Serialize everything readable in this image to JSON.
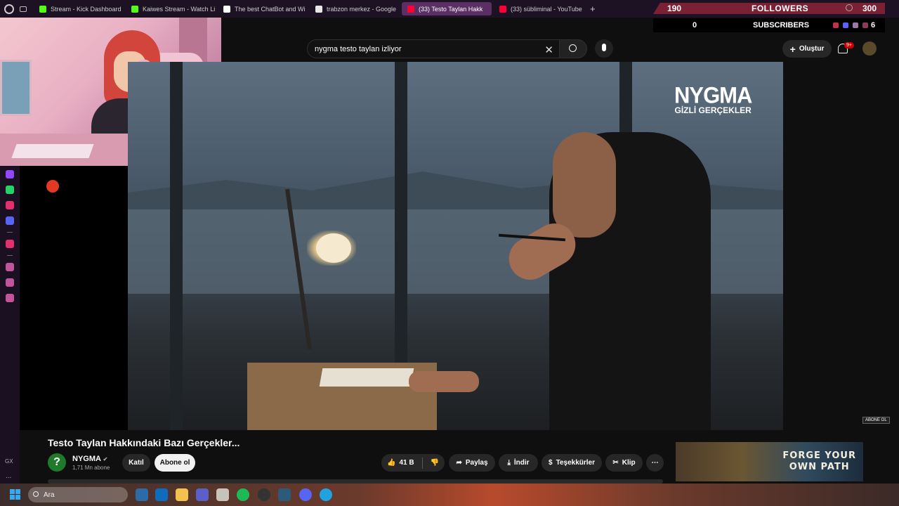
{
  "browser": {
    "tabs": [
      {
        "label": "Stream - Kick Dashboard",
        "color": "#53fc18",
        "active": false
      },
      {
        "label": "Kaiwes Stream - Watch Li",
        "color": "#53fc18",
        "active": false
      },
      {
        "label": "The best ChatBot and Wi",
        "color": "#ffffff",
        "active": false
      },
      {
        "label": "trabzon merkez - Google",
        "color": "#e8e8e8",
        "active": false
      },
      {
        "label": "(33) Testo Taylan Hakk",
        "color": "#ff0033",
        "active": true
      },
      {
        "label": "(33) sübliminal - YouTube",
        "color": "#ff0033",
        "active": false
      }
    ],
    "new_tab": "+"
  },
  "stream_overlay": {
    "followers_count": "190",
    "followers_label": "FOLLOWERS",
    "top_right_count": "300",
    "subscribers_count": "0",
    "subscribers_label": "SUBSCRIBERS",
    "small_count": "6"
  },
  "sidebar": {
    "icons": [
      {
        "name": "twitch-icon",
        "color": "#9146ff"
      },
      {
        "name": "whatsapp-icon",
        "color": "#25d366"
      },
      {
        "name": "instagram-icon",
        "color": "#e1306c"
      },
      {
        "name": "discord-icon",
        "color": "#5865f2"
      },
      {
        "name": "music-icon",
        "color": "#e1306c"
      },
      {
        "name": "history-icon",
        "color": "#c1559c"
      },
      {
        "name": "extensions-icon",
        "color": "#c1559c"
      },
      {
        "name": "settings-icon",
        "color": "#c1559c"
      }
    ],
    "gx_label": "GX",
    "more_label": "..."
  },
  "youtube": {
    "search_query": "nygma testo taylan izliyor",
    "create_label": "Oluştur",
    "notif_badge": "9+",
    "video": {
      "overlay_title": "NYGMA",
      "overlay_subtitle": "GİZLİ GERÇEKLER",
      "subscribe_watermark": "ABONE OL",
      "title": "Testo Taylan Hakkındaki Bazı Gerçekler...",
      "channel_initial": "?",
      "channel_name": "NYGMA",
      "channel_verified": "✔",
      "channel_subs": "1,71 Mn abone",
      "join_label": "Katıl",
      "subscribe_label": "Abone ol",
      "likes": "41 B",
      "share_label": "Paylaş",
      "download_label": "İndir",
      "thanks_label": "Teşekkürler",
      "clip_label": "Klip",
      "more_label": "⋯"
    },
    "ad": {
      "text_line1": "FORGE YOUR",
      "text_line2": "OWN PATH"
    }
  },
  "taskbar": {
    "search_placeholder": "Ara"
  }
}
